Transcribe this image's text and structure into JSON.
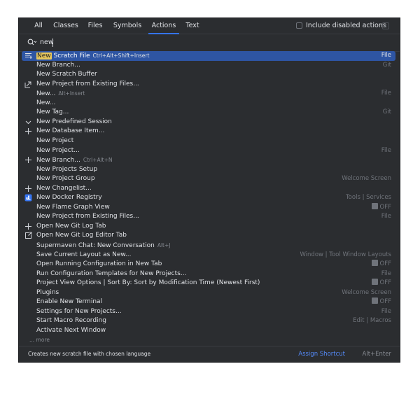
{
  "tabs": [
    {
      "label": "All"
    },
    {
      "label": "Classes"
    },
    {
      "label": "Files"
    },
    {
      "label": "Symbols"
    },
    {
      "label": "Actions"
    },
    {
      "label": "Text"
    }
  ],
  "active_tab": "Actions",
  "include_disabled": {
    "label": "Include disabled actions",
    "checked": false
  },
  "search": {
    "value": "new",
    "placeholder": ""
  },
  "results": [
    {
      "icon": "scratch-file-icon",
      "highlight": "New",
      "rest": " Scratch File",
      "shortcut": "Ctrl+Alt+Shift+Insert",
      "right": "File",
      "selected": true
    },
    {
      "icon": "",
      "name": "New Branch...",
      "shortcut": "",
      "right": "Git"
    },
    {
      "icon": "",
      "name": "New Scratch Buffer",
      "shortcut": "",
      "right": ""
    },
    {
      "icon": "project-from-files-icon",
      "name": "New Project from Existing Files...",
      "shortcut": "",
      "right": ""
    },
    {
      "icon": "",
      "name": "New...",
      "shortcut": "Alt+Insert",
      "right": "File"
    },
    {
      "icon": "",
      "name": "New...",
      "shortcut": "",
      "right": ""
    },
    {
      "icon": "",
      "name": "New Tag...",
      "shortcut": "",
      "right": "Git"
    },
    {
      "icon": "chevron-down-icon",
      "name": "New Predefined Session",
      "shortcut": "",
      "right": ""
    },
    {
      "icon": "plus-icon",
      "name": "New Database Item...",
      "shortcut": "",
      "right": ""
    },
    {
      "icon": "",
      "name": "New Project",
      "shortcut": "",
      "right": ""
    },
    {
      "icon": "",
      "name": "New Project...",
      "shortcut": "",
      "right": "File"
    },
    {
      "icon": "plus-icon",
      "name": "New Branch...",
      "shortcut": "Ctrl+Alt+N",
      "right": ""
    },
    {
      "icon": "",
      "name": "New Projects Setup",
      "shortcut": "",
      "right": ""
    },
    {
      "icon": "",
      "name": "New Project Group",
      "shortcut": "",
      "right": "Welcome Screen"
    },
    {
      "icon": "plus-icon",
      "name": "New Changelist...",
      "shortcut": "",
      "right": ""
    },
    {
      "icon": "docker-icon",
      "name": "New Docker Registry",
      "shortcut": "",
      "right": "Tools | Services"
    },
    {
      "icon": "",
      "name": "New Flame Graph View",
      "shortcut": "",
      "right": "",
      "toggle": "OFF"
    },
    {
      "icon": "",
      "name": "New Project from Existing Files...",
      "shortcut": "",
      "right": "File"
    },
    {
      "icon": "plus-icon",
      "name": "Open New Git Log Tab",
      "shortcut": "",
      "right": ""
    },
    {
      "icon": "open-in-new-icon",
      "name": "Open New Git Log Editor Tab",
      "shortcut": "",
      "right": ""
    },
    {
      "icon": "",
      "name": "Supermaven Chat: New Conversation",
      "shortcut": "Alt+J",
      "right": ""
    },
    {
      "icon": "",
      "name": "Save Current Layout as New...",
      "shortcut": "",
      "right": "Window | Tool Window Layouts"
    },
    {
      "icon": "",
      "name": "Open Running Configuration in New Tab",
      "shortcut": "",
      "right": "",
      "toggle": "OFF"
    },
    {
      "icon": "",
      "name": "Run Configuration Templates for New Projects...",
      "shortcut": "",
      "right": "File"
    },
    {
      "icon": "",
      "name": "Project View Options | Sort By: Sort by Modification Time (Newest First)",
      "shortcut": "",
      "right": "",
      "toggle": "OFF"
    },
    {
      "icon": "",
      "name": "Plugins",
      "shortcut": "",
      "right": "Welcome Screen"
    },
    {
      "icon": "",
      "name": "Enable New Terminal",
      "shortcut": "",
      "right": "",
      "toggle": "OFF"
    },
    {
      "icon": "",
      "name": "Settings for New Projects...",
      "shortcut": "",
      "right": "File"
    },
    {
      "icon": "",
      "name": "Start Macro Recording",
      "shortcut": "",
      "right": "Edit | Macros"
    },
    {
      "icon": "",
      "name": "Activate Next Window",
      "shortcut": "",
      "right": ""
    }
  ],
  "more_label": "... more",
  "footer": {
    "description": "Creates new scratch file with chosen language",
    "assign_label": "Assign Shortcut",
    "assign_key": "Alt+Enter"
  },
  "colors": {
    "background": "#2b2d30",
    "selection": "#2e55a3",
    "accent": "#3574f0",
    "link": "#548af7",
    "highlight": "#e7c75c"
  }
}
